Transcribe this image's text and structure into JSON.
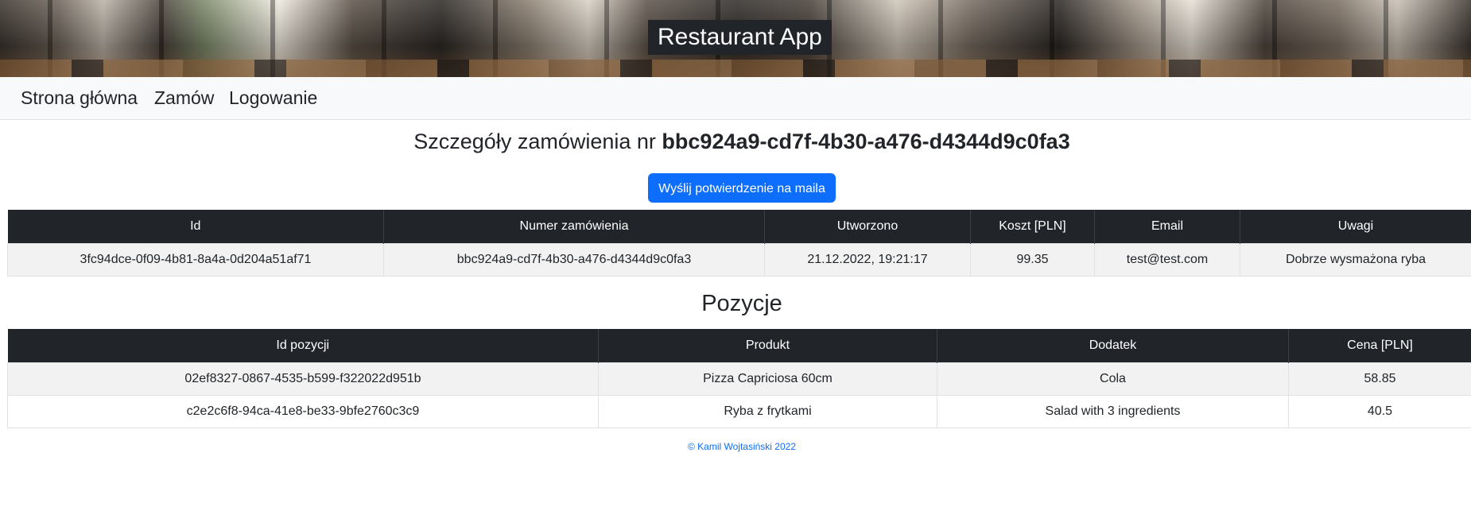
{
  "header": {
    "app_title": "Restaurant App"
  },
  "navbar": {
    "items": [
      {
        "label": "Strona główna"
      },
      {
        "label": "Zamów"
      },
      {
        "label": "Logowanie"
      }
    ]
  },
  "order": {
    "heading_prefix": "Szczegóły zamówienia nr",
    "order_number": "bbc924a9-cd7f-4b30-a476-d4344d9c0fa3",
    "send_button_label": "Wyślij potwierdzenie na maila",
    "table": {
      "columns": [
        "Id",
        "Numer zamówienia",
        "Utworzono",
        "Koszt [PLN]",
        "Email",
        "Uwagi"
      ],
      "row": {
        "id": "3fc94dce-0f09-4b81-8a4a-0d204a51af71",
        "number": "bbc924a9-cd7f-4b30-a476-d4344d9c0fa3",
        "created": "21.12.2022, 19:21:17",
        "cost": "99.35",
        "email": "test@test.com",
        "notes": "Dobrze wysmażona ryba"
      }
    }
  },
  "positions": {
    "heading": "Pozycje",
    "columns": [
      "Id pozycji",
      "Produkt",
      "Dodatek",
      "Cena [PLN]"
    ],
    "rows": [
      {
        "id": "02ef8327-0867-4535-b599-f322022d951b",
        "product": "Pizza Capriciosa 60cm",
        "addon": "Cola",
        "price": "58.85"
      },
      {
        "id": "c2e2c6f8-94ca-41e8-be33-9bfe2760c3c9",
        "product": "Ryba z frytkami",
        "addon": "Salad with 3 ingredients",
        "price": "40.5"
      }
    ]
  },
  "footer": {
    "text": "© Kamil Wojtasiński 2022"
  },
  "colors": {
    "primary": "#0d6efd",
    "dark": "#212529",
    "navbar_bg": "#f8f9fa"
  }
}
